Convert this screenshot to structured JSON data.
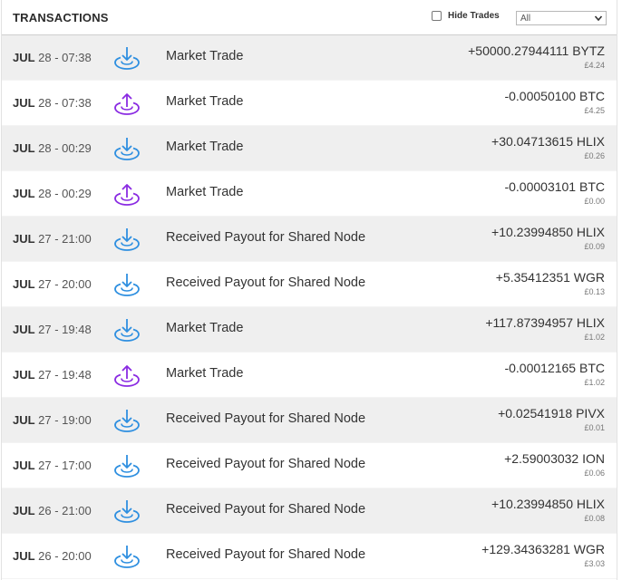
{
  "header": {
    "title": "TRANSACTIONS",
    "hide_trades_label": "Hide Trades",
    "filter_selected": "All"
  },
  "colors": {
    "in_icon": "#2e8fe0",
    "out_icon": "#8a2be2",
    "row_shade": "#efefef"
  },
  "transactions": [
    {
      "month": "JUL",
      "rest": " 28 - 07:38",
      "direction": "in",
      "icon": "download-icon",
      "description": "Market Trade",
      "amount": "+50000.27944111 BYTZ",
      "fiat": "£4.24"
    },
    {
      "month": "JUL",
      "rest": " 28 - 07:38",
      "direction": "out",
      "icon": "upload-icon",
      "description": "Market Trade",
      "amount": "-0.00050100 BTC",
      "fiat": "£4.25"
    },
    {
      "month": "JUL",
      "rest": " 28 - 00:29",
      "direction": "in",
      "icon": "download-icon",
      "description": "Market Trade",
      "amount": "+30.04713615 HLIX",
      "fiat": "£0.26"
    },
    {
      "month": "JUL",
      "rest": " 28 - 00:29",
      "direction": "out",
      "icon": "upload-icon",
      "description": "Market Trade",
      "amount": "-0.00003101 BTC",
      "fiat": "£0.00"
    },
    {
      "month": "JUL",
      "rest": " 27 - 21:00",
      "direction": "in",
      "icon": "download-icon",
      "description": "Received Payout for Shared Node",
      "amount": "+10.23994850 HLIX",
      "fiat": "£0.09"
    },
    {
      "month": "JUL",
      "rest": " 27 - 20:00",
      "direction": "in",
      "icon": "download-icon",
      "description": "Received Payout for Shared Node",
      "amount": "+5.35412351 WGR",
      "fiat": "£0.13"
    },
    {
      "month": "JUL",
      "rest": " 27 - 19:48",
      "direction": "in",
      "icon": "download-icon",
      "description": "Market Trade",
      "amount": "+117.87394957 HLIX",
      "fiat": "£1.02"
    },
    {
      "month": "JUL",
      "rest": " 27 - 19:48",
      "direction": "out",
      "icon": "upload-icon",
      "description": "Market Trade",
      "amount": "-0.00012165 BTC",
      "fiat": "£1.02"
    },
    {
      "month": "JUL",
      "rest": " 27 - 19:00",
      "direction": "in",
      "icon": "download-icon",
      "description": "Received Payout for Shared Node",
      "amount": "+0.02541918 PIVX",
      "fiat": "£0.01"
    },
    {
      "month": "JUL",
      "rest": " 27 - 17:00",
      "direction": "in",
      "icon": "download-icon",
      "description": "Received Payout for Shared Node",
      "amount": "+2.59003032 ION",
      "fiat": "£0.06"
    },
    {
      "month": "JUL",
      "rest": " 26 - 21:00",
      "direction": "in",
      "icon": "download-icon",
      "description": "Received Payout for Shared Node",
      "amount": "+10.23994850 HLIX",
      "fiat": "£0.08"
    },
    {
      "month": "JUL",
      "rest": " 26 - 20:00",
      "direction": "in",
      "icon": "download-icon",
      "description": "Received Payout for Shared Node",
      "amount": "+129.34363281 WGR",
      "fiat": "£3.03"
    }
  ]
}
